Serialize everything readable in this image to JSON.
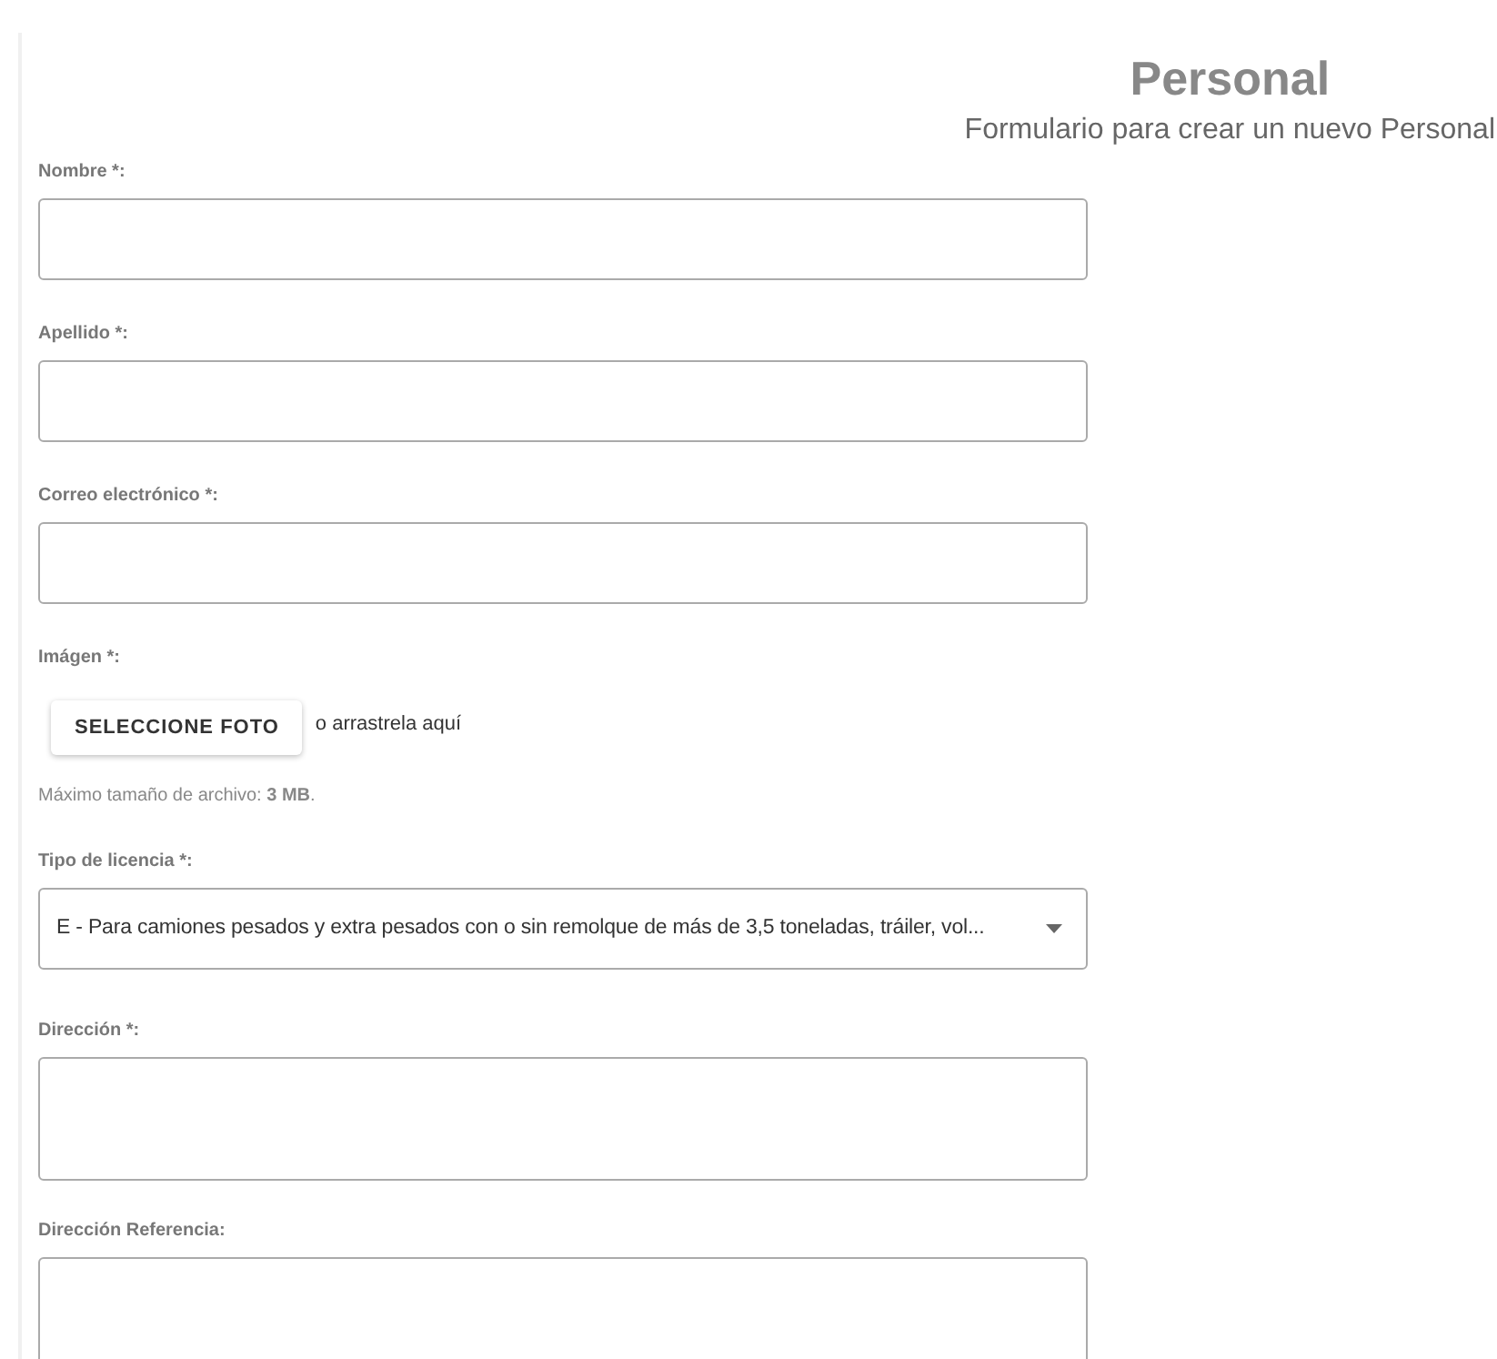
{
  "header": {
    "title": "Personal",
    "subtitle": "Formulario para crear un nuevo Personal"
  },
  "fields": [
    {
      "kind": "text",
      "label": "Nombre *:"
    },
    {
      "kind": "text",
      "label": "Apellido *:"
    },
    {
      "kind": "text",
      "label": "Correo electrónico *:"
    },
    {
      "kind": "file",
      "label": "Imágen *:",
      "button": "SELECCIONE FOTO",
      "drop_hint": "o arrastrela aquí",
      "note": "Máximo tamaño de archivo: **3 MB**."
    },
    {
      "kind": "select",
      "label": "Tipo de licencia *:",
      "value": "E - Para camiones pesados y extra pesados con o sin remolque de más de 3,5 toneladas, tráiler, vol..."
    },
    {
      "kind": "textarea",
      "label": "Dirección *:"
    },
    {
      "kind": "textarea",
      "label": "Dirección Referencia:"
    }
  ]
}
